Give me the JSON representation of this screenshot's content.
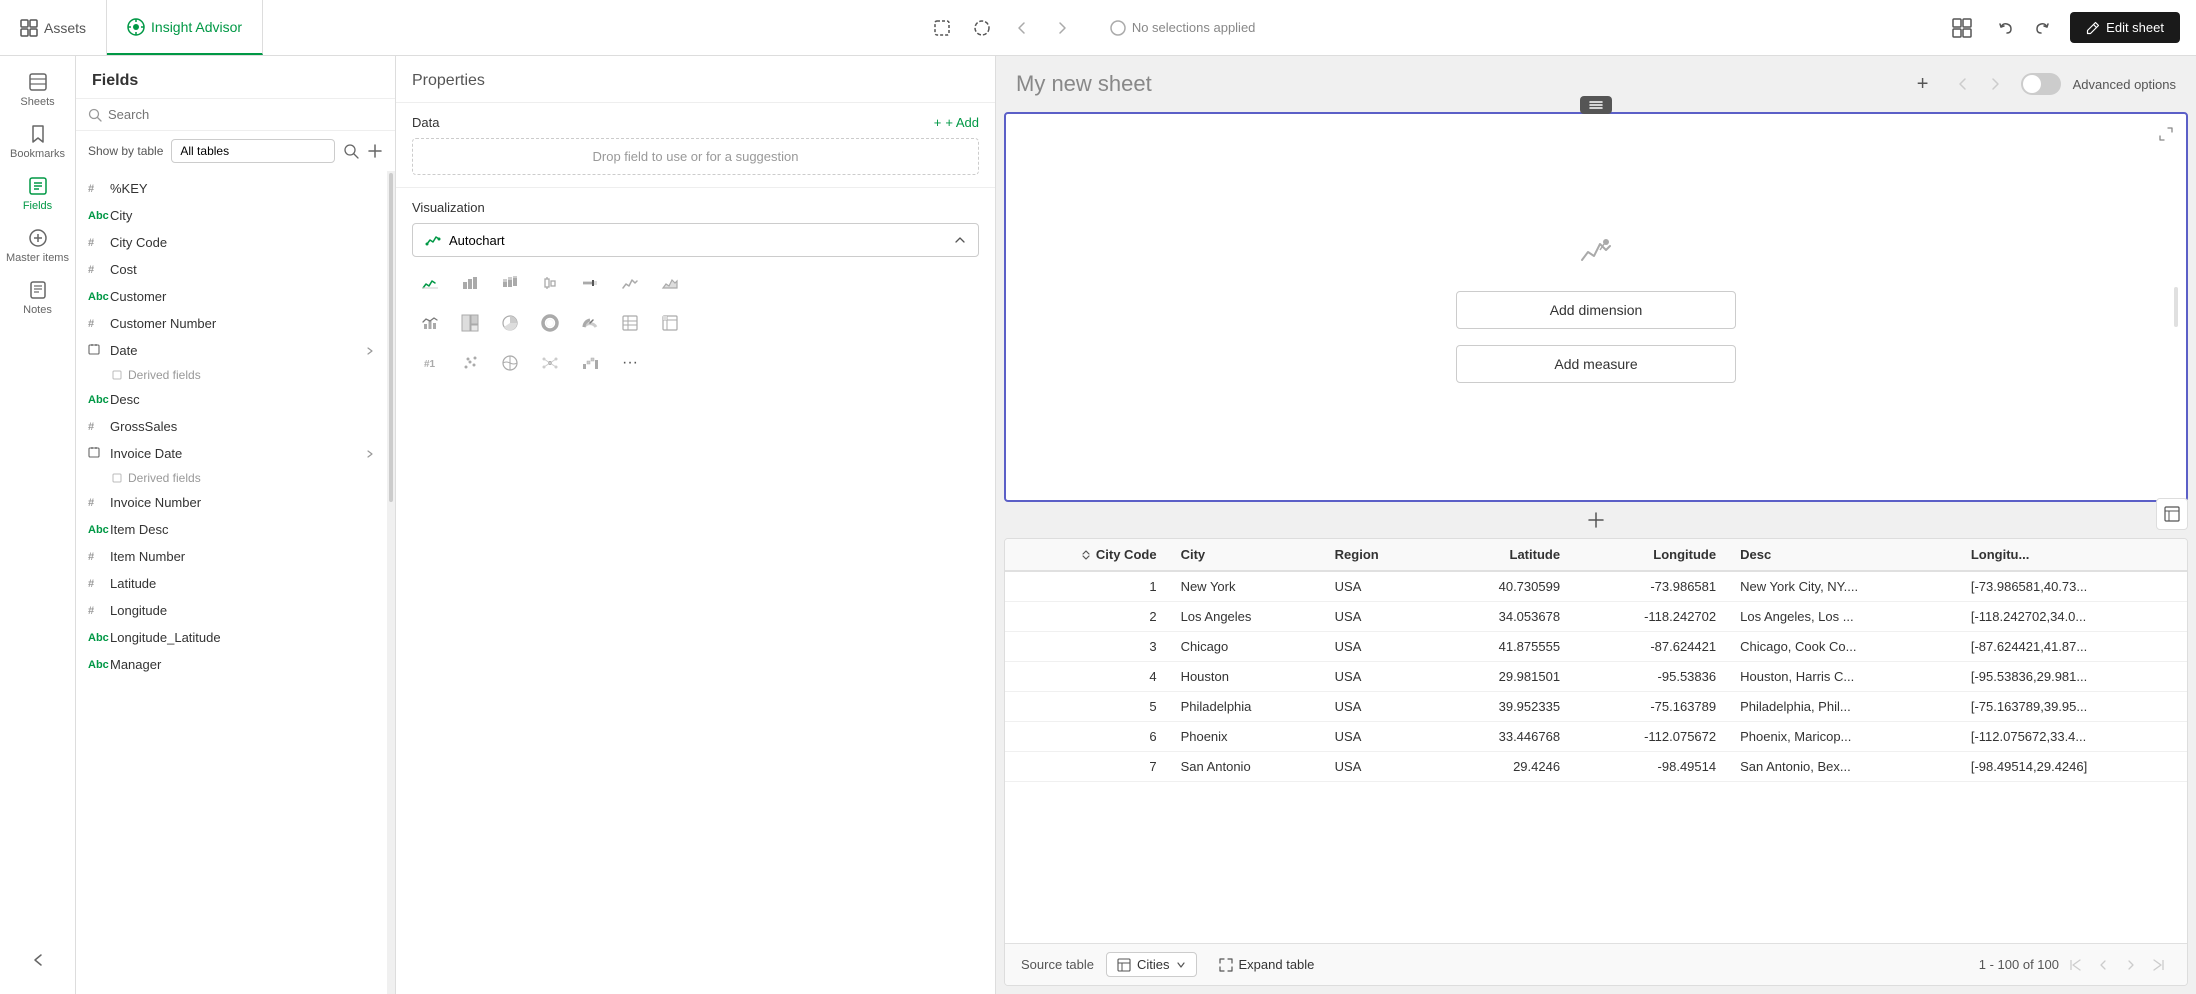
{
  "topbar": {
    "tabs": [
      {
        "label": "Assets",
        "active": false
      },
      {
        "label": "Insight Advisor",
        "active": true
      }
    ],
    "toolbar_icons": [
      "select",
      "lasso",
      "back",
      "forward"
    ],
    "no_selections_label": "No selections applied",
    "grid_icon": "grid",
    "edit_sheet_label": "Edit sheet",
    "undo_label": "undo",
    "redo_label": "redo"
  },
  "sidebar": {
    "items": [
      {
        "label": "Sheets",
        "icon": "sheets"
      },
      {
        "label": "Bookmarks",
        "icon": "bookmarks"
      },
      {
        "label": "Fields",
        "icon": "fields",
        "active": true
      },
      {
        "label": "Master items",
        "icon": "master-items"
      },
      {
        "label": "Notes",
        "icon": "notes"
      }
    ],
    "collapse_label": "collapse"
  },
  "fields_panel": {
    "title": "Fields",
    "search_placeholder": "Search",
    "show_by_table_label": "Show by table",
    "table_options": [
      "All tables"
    ],
    "selected_table": "All tables",
    "fields": [
      {
        "type": "#",
        "name": "%KEY"
      },
      {
        "type": "Abc",
        "name": "City"
      },
      {
        "type": "#",
        "name": "City Code"
      },
      {
        "type": "#",
        "name": "Cost"
      },
      {
        "type": "Abc",
        "name": "Customer"
      },
      {
        "type": "#",
        "name": "Customer Number"
      },
      {
        "type": "cal",
        "name": "Date",
        "has_derived": true
      },
      {
        "type": "Abc",
        "name": "Desc"
      },
      {
        "type": "#",
        "name": "GrossSales"
      },
      {
        "type": "cal",
        "name": "Invoice Date",
        "has_derived": true
      },
      {
        "type": "#",
        "name": "Invoice Number"
      },
      {
        "type": "Abc",
        "name": "Item Desc"
      },
      {
        "type": "#",
        "name": "Item Number"
      },
      {
        "type": "#",
        "name": "Latitude"
      },
      {
        "type": "#",
        "name": "Longitude"
      },
      {
        "type": "Abc",
        "name": "Longitude_Latitude"
      },
      {
        "type": "Abc",
        "name": "Manager"
      }
    ],
    "derived_label": "Derived fields"
  },
  "properties_panel": {
    "title": "Properties",
    "data_label": "Data",
    "add_label": "+ Add",
    "drop_field_placeholder": "Drop field to use or for a suggestion",
    "visualization_label": "Visualization",
    "chart_type": "Autochart",
    "chart_icons": [
      "auto",
      "bar",
      "stacked-bar",
      "box",
      "bullet",
      "line",
      "area",
      "combo",
      "treemap",
      "pie",
      "donut",
      "gauge",
      "table",
      "pivot",
      "kpi",
      "scatter",
      "map",
      "network",
      "waterfall",
      "more"
    ]
  },
  "sheet": {
    "title": "My new sheet",
    "add_dimension_label": "Add dimension",
    "add_measure_label": "Add measure",
    "advanced_options_label": "Advanced options"
  },
  "table": {
    "columns": [
      {
        "label": "City Code",
        "align": "right"
      },
      {
        "label": "City",
        "align": "left"
      },
      {
        "label": "Region",
        "align": "left"
      },
      {
        "label": "Latitude",
        "align": "right"
      },
      {
        "label": "Longitude",
        "align": "right"
      },
      {
        "label": "Desc",
        "align": "left"
      },
      {
        "label": "Longitu...",
        "align": "left"
      }
    ],
    "rows": [
      {
        "city_code": "1",
        "city": "New York",
        "region": "USA",
        "latitude": "40.730599",
        "longitude": "-73.986581",
        "desc": "New York City, NY....",
        "longitu": "[-73.986581,40.73..."
      },
      {
        "city_code": "2",
        "city": "Los Angeles",
        "region": "USA",
        "latitude": "34.053678",
        "longitude": "-118.242702",
        "desc": "Los Angeles, Los ...",
        "longitu": "[-118.242702,34.0..."
      },
      {
        "city_code": "3",
        "city": "Chicago",
        "region": "USA",
        "latitude": "41.875555",
        "longitude": "-87.624421",
        "desc": "Chicago, Cook Co...",
        "longitu": "[-87.624421,41.87..."
      },
      {
        "city_code": "4",
        "city": "Houston",
        "region": "USA",
        "latitude": "29.981501",
        "longitude": "-95.53836",
        "desc": "Houston, Harris C...",
        "longitu": "[-95.53836,29.981..."
      },
      {
        "city_code": "5",
        "city": "Philadelphia",
        "region": "USA",
        "latitude": "39.952335",
        "longitude": "-75.163789",
        "desc": "Philadelphia, Phil...",
        "longitu": "[-75.163789,39.95..."
      },
      {
        "city_code": "6",
        "city": "Phoenix",
        "region": "USA",
        "latitude": "33.446768",
        "longitude": "-112.075672",
        "desc": "Phoenix, Maricop...",
        "longitu": "[-112.075672,33.4..."
      },
      {
        "city_code": "7",
        "city": "San Antonio",
        "region": "USA",
        "latitude": "29.4246",
        "longitude": "-98.49514",
        "desc": "San Antonio, Bex...",
        "longitu": "[-98.49514,29.4246]"
      }
    ],
    "source_table_label": "Source table",
    "source_table_name": "Cities",
    "expand_table_label": "Expand table",
    "pagination": "1 - 100 of 100"
  }
}
